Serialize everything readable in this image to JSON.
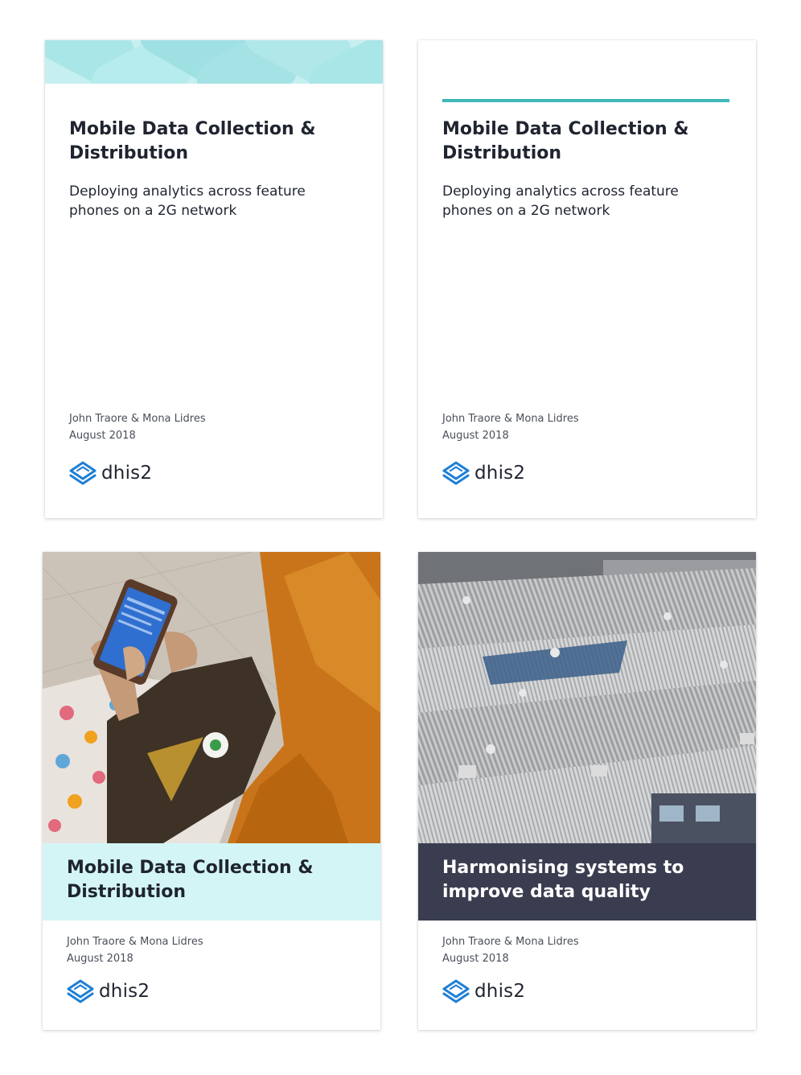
{
  "colors": {
    "accent": "#3fb8b8",
    "band_light": "#d4f5f5",
    "band_dark": "#393d4f",
    "logo_blue": "#1e7fd6"
  },
  "cards": [
    {
      "variant": "pattern-header",
      "title": "Mobile Data Collection & Distribution",
      "subtitle": "Deploying analytics across feature phones on a 2G network",
      "authors": "John Traore & Mona Lidres",
      "date": "August 2018",
      "logo_text": "dhis2"
    },
    {
      "variant": "accent-line",
      "title": "Mobile Data Collection & Distribution",
      "subtitle": "Deploying analytics across feature phones on a 2G network",
      "authors": "John Traore & Mona Lidres",
      "date": "August 2018",
      "logo_text": "dhis2"
    },
    {
      "variant": "photo-light",
      "photo": "woman-using-smartphone-photo",
      "title": "Mobile Data Collection & Distribution",
      "authors": "John Traore & Mona Lidres",
      "date": "August 2018",
      "logo_text": "dhis2"
    },
    {
      "variant": "photo-dark",
      "photo": "corrugated-rooftops-photo",
      "title": "Harmonising systems to improve data quality",
      "authors": "John Traore & Mona Lidres",
      "date": "August 2018",
      "logo_text": "dhis2"
    }
  ]
}
